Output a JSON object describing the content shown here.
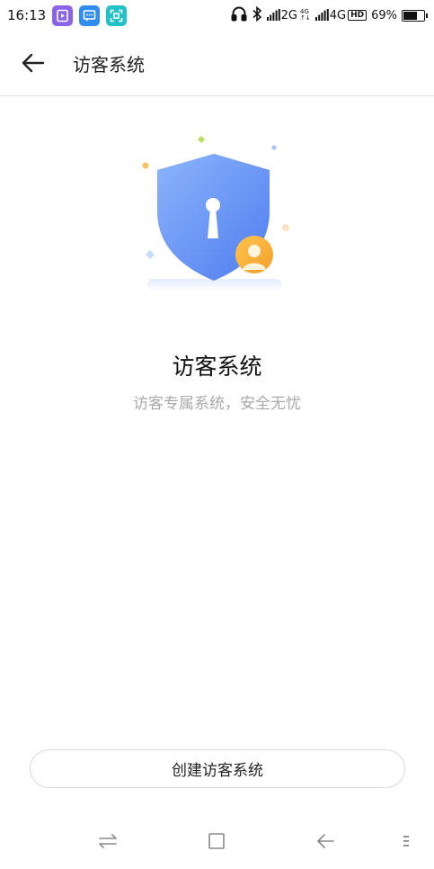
{
  "status_bar": {
    "time": "16:13",
    "app_icons": [
      "video-app-icon",
      "message-app-icon",
      "scan-app-icon"
    ],
    "network1": "2G",
    "network_small_top": "4G",
    "network_small_bottom": "↑↓",
    "network2": "4G",
    "hd": "HD",
    "battery_percent": "69%",
    "battery_level": 0.69
  },
  "header": {
    "title": "访客系统"
  },
  "hero": {
    "title": "访客系统",
    "subtitle": "访客专属系统，安全无忧"
  },
  "actions": {
    "create_label": "创建访客系统"
  },
  "colors": {
    "shield_blue": "#6b96f7",
    "avatar_orange": "#f5b43a",
    "video_app": "#8a63e6",
    "message_app": "#2f8df0",
    "scan_app": "#22c1c8"
  }
}
